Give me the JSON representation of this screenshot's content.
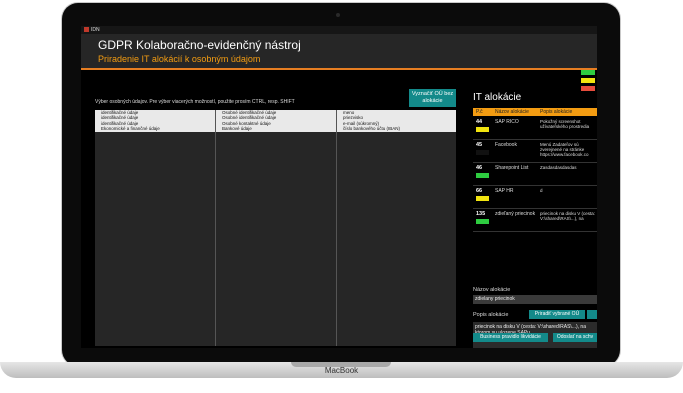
{
  "app": {
    "name": "IDN"
  },
  "header": {
    "title": "GDPR Kolaboračno-evidenčný nástroj",
    "subtitle": "Priradenie IT alokácií k osobným údajom"
  },
  "legend_colors": [
    "#2ecc40",
    "#f1e40f",
    "#e74c3c"
  ],
  "selection_hint": "Výber osobných údajov. Pre výber viacerých možností, použite prosím CTRL, resp. SHIFT",
  "mark_button": {
    "line1": "Vyznačiť OÚ bez",
    "line2": "alokácie"
  },
  "table": {
    "columns": [
      {
        "cells": [
          "identifikačné údaje",
          "identifikačné údaje",
          "identifikačné údaje",
          "Ekonomické a finančné údaje"
        ]
      },
      {
        "cells": [
          "Osobné identifikačné údaje",
          "Osobné identifikačné údaje",
          "Osobné kontaktné údaje",
          "Bankové údaje"
        ]
      },
      {
        "cells": [
          "meno",
          "priezvisko",
          "e-mail (súkromný)",
          "číslo bankového účtu (IBAN)"
        ]
      }
    ]
  },
  "it_allocations": {
    "title": "IT alokácie",
    "headers": {
      "num": "P.č",
      "name": "Názov alokácie",
      "desc": "Popis alokácie"
    },
    "rows": [
      {
        "num": "44",
        "status_color": "#f1e40f",
        "name": "SAP RICO",
        "desc": "Pokožný screenshot užívateľského prostredia"
      },
      {
        "num": "45",
        "status_color": "#111111",
        "name": "Facebook",
        "desc": "Menú Zadateľov sú zverejnené na stránke https://www.facebook.co"
      },
      {
        "num": "46",
        "status_color": "#2ecc40",
        "name": "Sharepoint List",
        "desc": "Zasdasdasdasdas"
      },
      {
        "num": "66",
        "status_color": "#f1e40f",
        "name": "SAP HR",
        "desc": "d"
      },
      {
        "num": "135",
        "status_color": "#2ecc40",
        "name": "zdieľaný priecinok",
        "desc": "priecinok na disku V (cesta: V:\\shared\\RAS\\...), na"
      }
    ]
  },
  "form": {
    "name_label": "Názov alokácie",
    "name_value": "zdielany priecinok",
    "desc_label": "Popis alokácie",
    "assign_button": "Priradiť vybrané OÚ",
    "desc_value": "priecinok na disku V (cesta: V:\\shared\\RAS\\...), na ktorom su ulozene SAPu",
    "rule_button": "Business pravidlo likvidácie",
    "remove_button": "Odoslať na schv"
  },
  "device": {
    "label": "MacBook"
  }
}
